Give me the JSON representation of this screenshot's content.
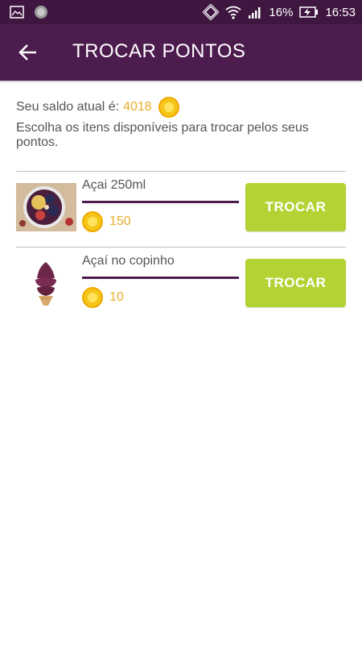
{
  "status_bar": {
    "battery_percent": "16%",
    "time": "16:53",
    "icons": [
      "image-icon",
      "circle-icon",
      "vibrate-icon",
      "wifi-icon",
      "signal-icon",
      "battery-charging-icon"
    ]
  },
  "app_bar": {
    "title": "TROCAR PONTOS",
    "back_icon": "arrow-back-icon"
  },
  "balance": {
    "label": "Seu saldo atual é:",
    "value": "4018",
    "icon": "coin-icon"
  },
  "instructions": "Escolha os itens disponíveis para trocar pelos seus pontos.",
  "items": [
    {
      "name": "Açai 250ml",
      "points": "150",
      "button_label": "TROCAR",
      "image": "acai-bowl-image"
    },
    {
      "name": "Açaí no copinho",
      "points": "10",
      "button_label": "TROCAR",
      "image": "acai-cone-image"
    }
  ],
  "colors": {
    "status_bar": "#3f1640",
    "app_bar": "#4d1c4e",
    "accent_gold": "#e9ad2b",
    "button_green": "#b3d334"
  }
}
